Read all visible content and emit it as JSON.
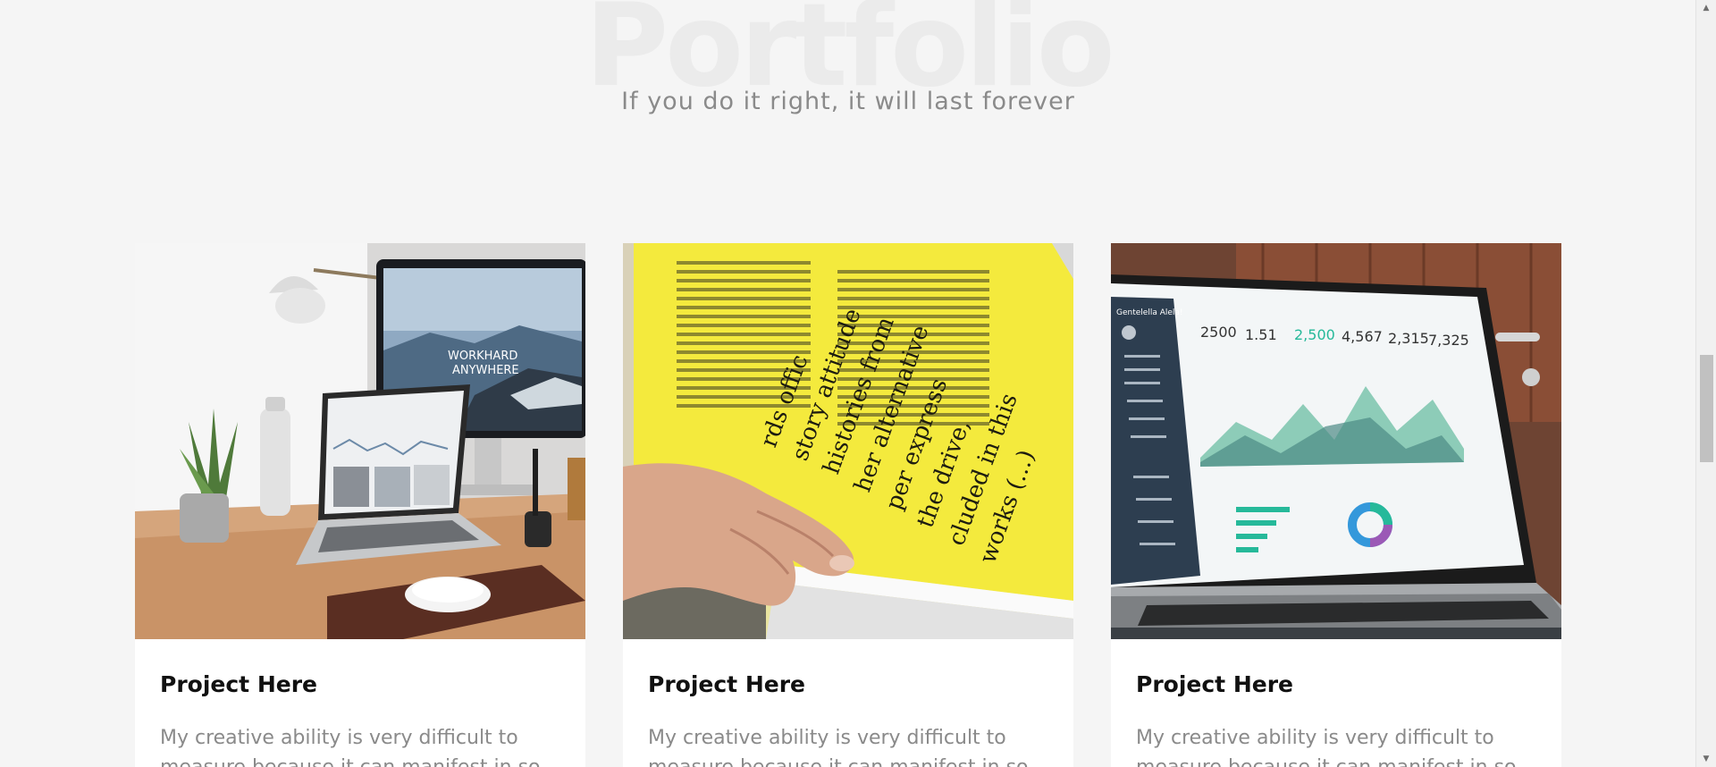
{
  "section": {
    "title": "Portfolio",
    "subtitle": "If you do it right, it will last forever"
  },
  "cards": [
    {
      "image": "workspace-desk-photo",
      "image_text": "WORKHARD ANYWHERE",
      "title": "Project Here",
      "text": "My creative ability is very difficult to measure because it can manifest in so"
    },
    {
      "image": "yellow-magazine-photo",
      "image_text": "works (...) cluded in this per express the drive, her alternative story attitude histories from rds offic",
      "title": "Project Here",
      "text": "My creative ability is very difficult to measure because it can manifest in so"
    },
    {
      "image": "analytics-laptop-photo",
      "image_text": "Gentelella Alela!",
      "title": "Project Here",
      "text": "My creative ability is very difficult to measure because it can manifest in so"
    }
  ],
  "scrollbar": {
    "position": 0.51,
    "up_icon": "triangle-up-icon",
    "down_icon": "triangle-down-icon"
  },
  "colors": {
    "page_background": "#f5f5f5",
    "title_watermark": "#ebebeb",
    "subtitle": "#8a8a8a",
    "card_background": "#ffffff",
    "card_title": "#111111",
    "magazine_yellow": "#f4ea3d"
  }
}
